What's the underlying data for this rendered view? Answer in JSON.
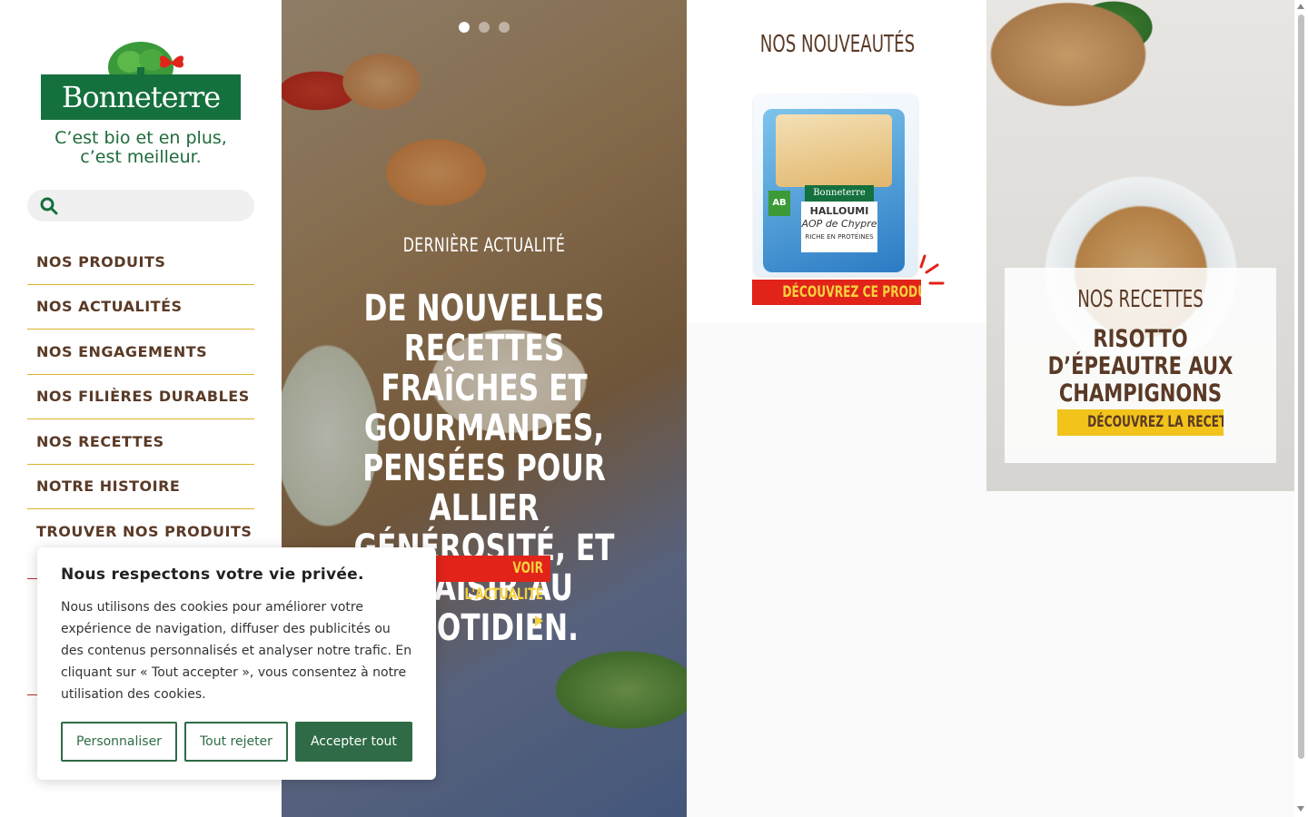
{
  "brand": {
    "name": "Bonneterre",
    "tagline_line1": "C’est bio et en plus,",
    "tagline_line2": "c’est meilleur."
  },
  "search": {
    "placeholder": "",
    "value": ""
  },
  "nav": {
    "items": [
      {
        "label": "NOS PRODUITS"
      },
      {
        "label": "NOS ACTUALITÉS"
      },
      {
        "label": "NOS ENGAGEMENTS"
      },
      {
        "label": "NOS FILIÈRES DURABLES"
      },
      {
        "label": "NOS RECETTES"
      },
      {
        "label": "NOTRE HISTOIRE"
      },
      {
        "label": "TROUVER NOS PRODUITS"
      }
    ]
  },
  "hero": {
    "kicker": "DERNIÈRE ACTUALITÉ",
    "title": "DE NOUVELLES RECETTES FRAÎCHES ET GOURMANDES, PENSÉES POUR ALLIER GÉNÉROSITÉ, ET PLAISIR AU QUOTIDIEN.",
    "cta": "VOIR L'ACTUALITÉ",
    "slides_total": 3,
    "active_slide": 1
  },
  "news": {
    "title": "NOS NOUVEAUTÉS",
    "product_brand": "Bonneterre",
    "product_name": "HALLOUMI",
    "product_sub": "AOP de Chypre",
    "product_note": "RICHE EN PROTÉINES",
    "bio_label": "AB",
    "cta": "DÉCOUVREZ CE PRODUIT"
  },
  "recipe": {
    "kicker": "NOS RECETTES",
    "title": "RISOTTO D’ÉPEAUTRE AUX CHAMPIGNONS",
    "cta": "DÉCOUVREZ LA RECETTE"
  },
  "cookie": {
    "title": "Nous respectons votre vie privée.",
    "body": "Nous utilisons des cookies pour améliorer votre expérience de navigation, diffuser des publicités ou des contenus personnalisés et analyser notre trafic. En cliquant sur « Tout accepter », vous consentez à notre utilisation des cookies.",
    "btn_customize": "Personnaliser",
    "btn_reject": "Tout rejeter",
    "btn_accept": "Accepter tout"
  },
  "colors": {
    "brand_green": "#14703d",
    "nav_text": "#5a3a26",
    "nav_divider": "#d9b42a",
    "cta_red": "#e2231a",
    "cta_yellow": "#f2c31a",
    "cookie_green": "#2e6b46"
  },
  "icons": {
    "search": "search-icon",
    "arrow": "play-arrow-icon",
    "butterfly": "butterfly-icon",
    "tree": "tree-icon"
  }
}
